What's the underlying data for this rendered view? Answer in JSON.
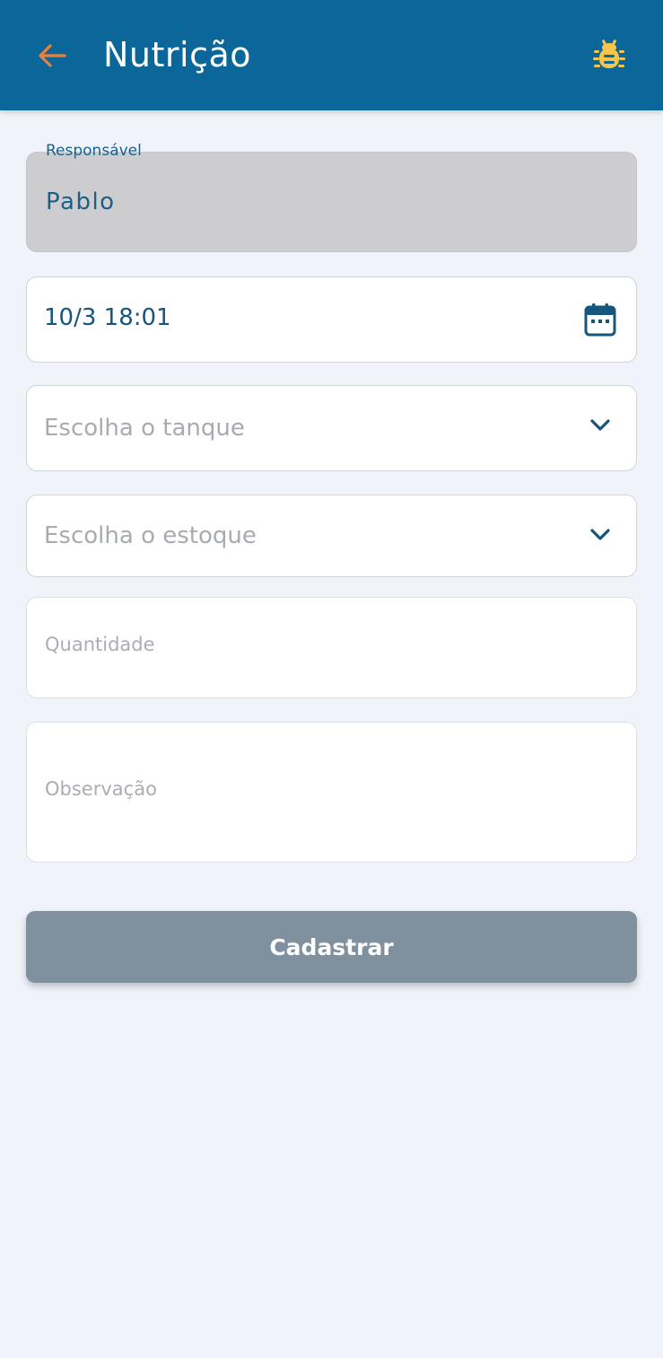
{
  "colors": {
    "app_bar": "#0b6699",
    "back_arrow": "#e8823a",
    "bug_icon": "#f5c64a",
    "background": "#f1f3fa",
    "button": "#7f909f",
    "value_text": "#15557e",
    "placeholder_text": "#a9abb2"
  },
  "header": {
    "back_icon": "arrow-left-icon",
    "title": "Nutrição",
    "debug_icon": "bug-icon"
  },
  "form": {
    "responsavel": {
      "label": "Responsável",
      "value": "Pablo"
    },
    "datetime": {
      "value": "10/3 18:01",
      "icon": "calendar-icon"
    },
    "tanque": {
      "placeholder": "Escolha o tanque",
      "icon": "chevron-down-icon"
    },
    "estoque": {
      "placeholder": "Escolha o estoque",
      "icon": "chevron-down-icon"
    },
    "quantidade": {
      "placeholder": "Quantidade"
    },
    "observacao": {
      "placeholder": "Observação"
    },
    "submit_label": "Cadastrar"
  }
}
